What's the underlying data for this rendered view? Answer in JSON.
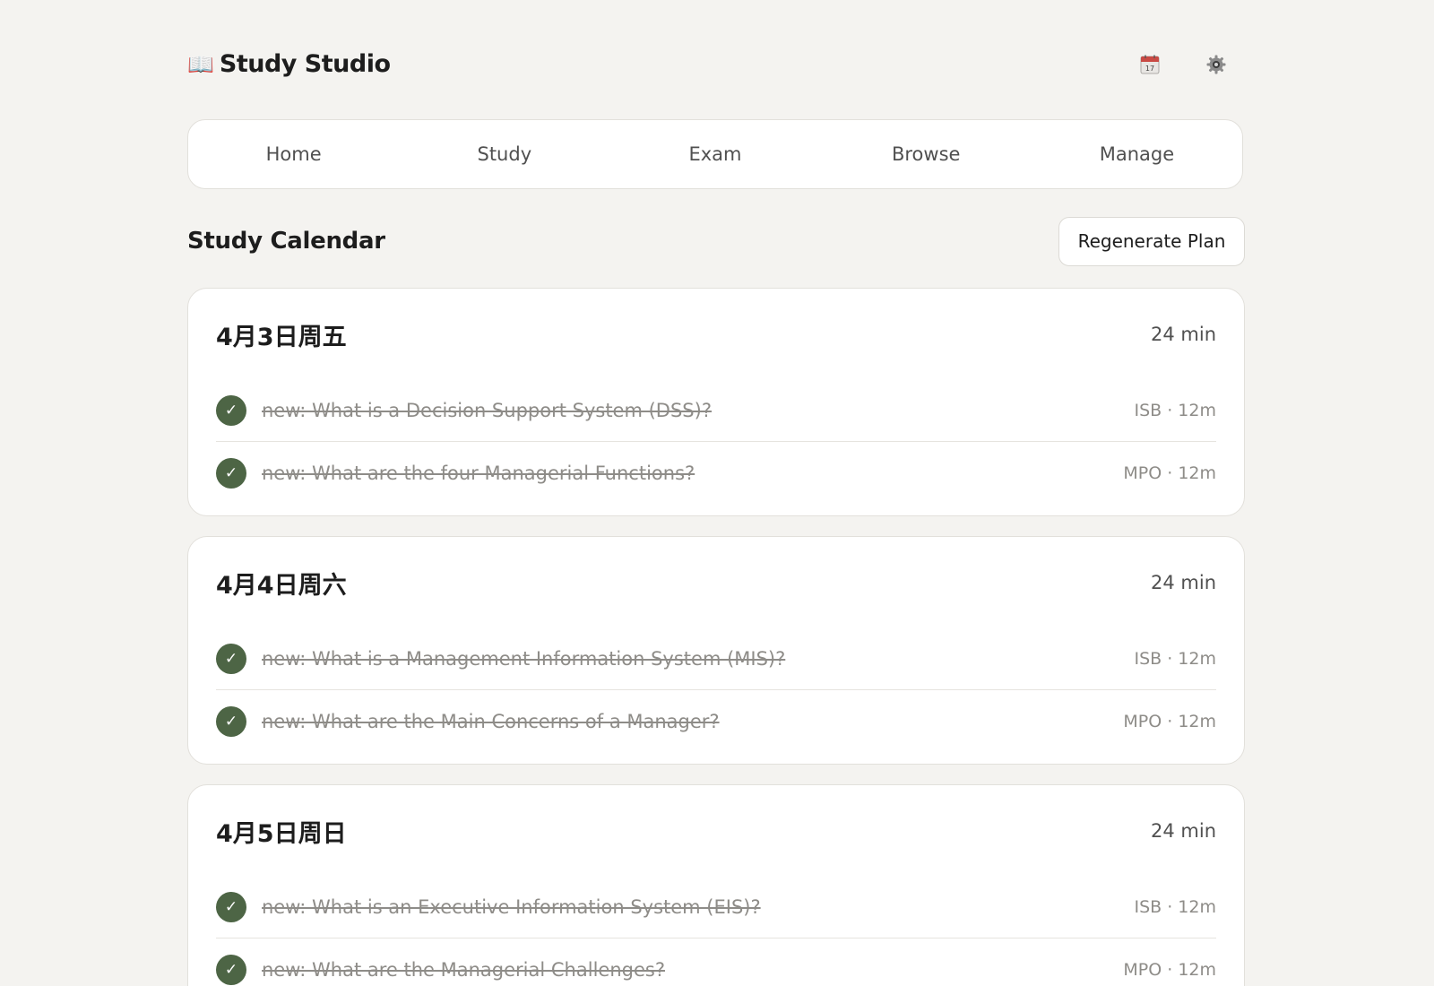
{
  "app": {
    "icon": "📖",
    "title": "Study Studio"
  },
  "header_icons": [
    "calendar-icon",
    "settings-icon"
  ],
  "nav": {
    "items": [
      "Home",
      "Study",
      "Exam",
      "Browse",
      "Manage"
    ]
  },
  "calendar": {
    "title": "Study Calendar",
    "regenerate_label": "Regenerate Plan",
    "days": [
      {
        "date": "4月3日周五",
        "total": "24 min",
        "tasks": [
          {
            "title": "new: What is a Decision Support System (DSS)?",
            "meta": "ISB · 12m",
            "done": true
          },
          {
            "title": "new: What are the four Managerial Functions?",
            "meta": "MPO · 12m",
            "done": true
          }
        ]
      },
      {
        "date": "4月4日周六",
        "total": "24 min",
        "tasks": [
          {
            "title": "new: What is a Management Information System (MIS)?",
            "meta": "ISB · 12m",
            "done": true
          },
          {
            "title": "new: What are the Main Concerns of a Manager?",
            "meta": "MPO · 12m",
            "done": true
          }
        ]
      },
      {
        "date": "4月5日周日",
        "total": "24 min",
        "tasks": [
          {
            "title": "new: What is an Executive Information System (EIS)?",
            "meta": "ISB · 12m",
            "done": true
          },
          {
            "title": "new: What are the Managerial Challenges?",
            "meta": "MPO · 12m",
            "done": true
          }
        ]
      }
    ]
  },
  "colors": {
    "background": "#f4f3f0",
    "card": "#ffffff",
    "accent_check": "#4d6545",
    "muted_text": "#8e8c88"
  }
}
